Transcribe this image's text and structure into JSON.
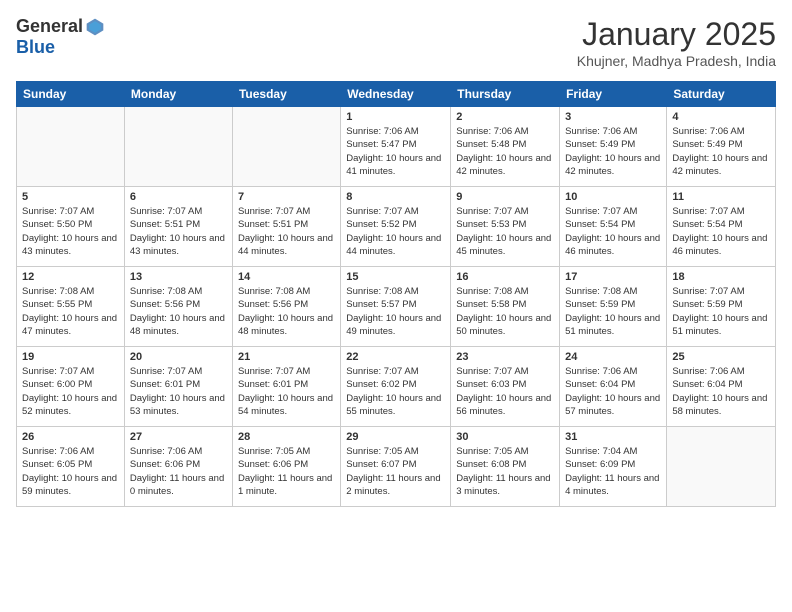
{
  "header": {
    "logo": {
      "general": "General",
      "blue": "Blue"
    },
    "title": "January 2025",
    "location": "Khujner, Madhya Pradesh, India"
  },
  "weekdays": [
    "Sunday",
    "Monday",
    "Tuesday",
    "Wednesday",
    "Thursday",
    "Friday",
    "Saturday"
  ],
  "weeks": [
    [
      {
        "day": "",
        "empty": true
      },
      {
        "day": "",
        "empty": true
      },
      {
        "day": "",
        "empty": true
      },
      {
        "day": "1",
        "sunrise": "7:06 AM",
        "sunset": "5:47 PM",
        "daylight": "10 hours and 41 minutes."
      },
      {
        "day": "2",
        "sunrise": "7:06 AM",
        "sunset": "5:48 PM",
        "daylight": "10 hours and 42 minutes."
      },
      {
        "day": "3",
        "sunrise": "7:06 AM",
        "sunset": "5:49 PM",
        "daylight": "10 hours and 42 minutes."
      },
      {
        "day": "4",
        "sunrise": "7:06 AM",
        "sunset": "5:49 PM",
        "daylight": "10 hours and 42 minutes."
      }
    ],
    [
      {
        "day": "5",
        "sunrise": "7:07 AM",
        "sunset": "5:50 PM",
        "daylight": "10 hours and 43 minutes."
      },
      {
        "day": "6",
        "sunrise": "7:07 AM",
        "sunset": "5:51 PM",
        "daylight": "10 hours and 43 minutes."
      },
      {
        "day": "7",
        "sunrise": "7:07 AM",
        "sunset": "5:51 PM",
        "daylight": "10 hours and 44 minutes."
      },
      {
        "day": "8",
        "sunrise": "7:07 AM",
        "sunset": "5:52 PM",
        "daylight": "10 hours and 44 minutes."
      },
      {
        "day": "9",
        "sunrise": "7:07 AM",
        "sunset": "5:53 PM",
        "daylight": "10 hours and 45 minutes."
      },
      {
        "day": "10",
        "sunrise": "7:07 AM",
        "sunset": "5:54 PM",
        "daylight": "10 hours and 46 minutes."
      },
      {
        "day": "11",
        "sunrise": "7:07 AM",
        "sunset": "5:54 PM",
        "daylight": "10 hours and 46 minutes."
      }
    ],
    [
      {
        "day": "12",
        "sunrise": "7:08 AM",
        "sunset": "5:55 PM",
        "daylight": "10 hours and 47 minutes."
      },
      {
        "day": "13",
        "sunrise": "7:08 AM",
        "sunset": "5:56 PM",
        "daylight": "10 hours and 48 minutes."
      },
      {
        "day": "14",
        "sunrise": "7:08 AM",
        "sunset": "5:56 PM",
        "daylight": "10 hours and 48 minutes."
      },
      {
        "day": "15",
        "sunrise": "7:08 AM",
        "sunset": "5:57 PM",
        "daylight": "10 hours and 49 minutes."
      },
      {
        "day": "16",
        "sunrise": "7:08 AM",
        "sunset": "5:58 PM",
        "daylight": "10 hours and 50 minutes."
      },
      {
        "day": "17",
        "sunrise": "7:08 AM",
        "sunset": "5:59 PM",
        "daylight": "10 hours and 51 minutes."
      },
      {
        "day": "18",
        "sunrise": "7:07 AM",
        "sunset": "5:59 PM",
        "daylight": "10 hours and 51 minutes."
      }
    ],
    [
      {
        "day": "19",
        "sunrise": "7:07 AM",
        "sunset": "6:00 PM",
        "daylight": "10 hours and 52 minutes."
      },
      {
        "day": "20",
        "sunrise": "7:07 AM",
        "sunset": "6:01 PM",
        "daylight": "10 hours and 53 minutes."
      },
      {
        "day": "21",
        "sunrise": "7:07 AM",
        "sunset": "6:01 PM",
        "daylight": "10 hours and 54 minutes."
      },
      {
        "day": "22",
        "sunrise": "7:07 AM",
        "sunset": "6:02 PM",
        "daylight": "10 hours and 55 minutes."
      },
      {
        "day": "23",
        "sunrise": "7:07 AM",
        "sunset": "6:03 PM",
        "daylight": "10 hours and 56 minutes."
      },
      {
        "day": "24",
        "sunrise": "7:06 AM",
        "sunset": "6:04 PM",
        "daylight": "10 hours and 57 minutes."
      },
      {
        "day": "25",
        "sunrise": "7:06 AM",
        "sunset": "6:04 PM",
        "daylight": "10 hours and 58 minutes."
      }
    ],
    [
      {
        "day": "26",
        "sunrise": "7:06 AM",
        "sunset": "6:05 PM",
        "daylight": "10 hours and 59 minutes."
      },
      {
        "day": "27",
        "sunrise": "7:06 AM",
        "sunset": "6:06 PM",
        "daylight": "11 hours and 0 minutes."
      },
      {
        "day": "28",
        "sunrise": "7:05 AM",
        "sunset": "6:06 PM",
        "daylight": "11 hours and 1 minute."
      },
      {
        "day": "29",
        "sunrise": "7:05 AM",
        "sunset": "6:07 PM",
        "daylight": "11 hours and 2 minutes."
      },
      {
        "day": "30",
        "sunrise": "7:05 AM",
        "sunset": "6:08 PM",
        "daylight": "11 hours and 3 minutes."
      },
      {
        "day": "31",
        "sunrise": "7:04 AM",
        "sunset": "6:09 PM",
        "daylight": "11 hours and 4 minutes."
      },
      {
        "day": "",
        "empty": true
      }
    ]
  ]
}
